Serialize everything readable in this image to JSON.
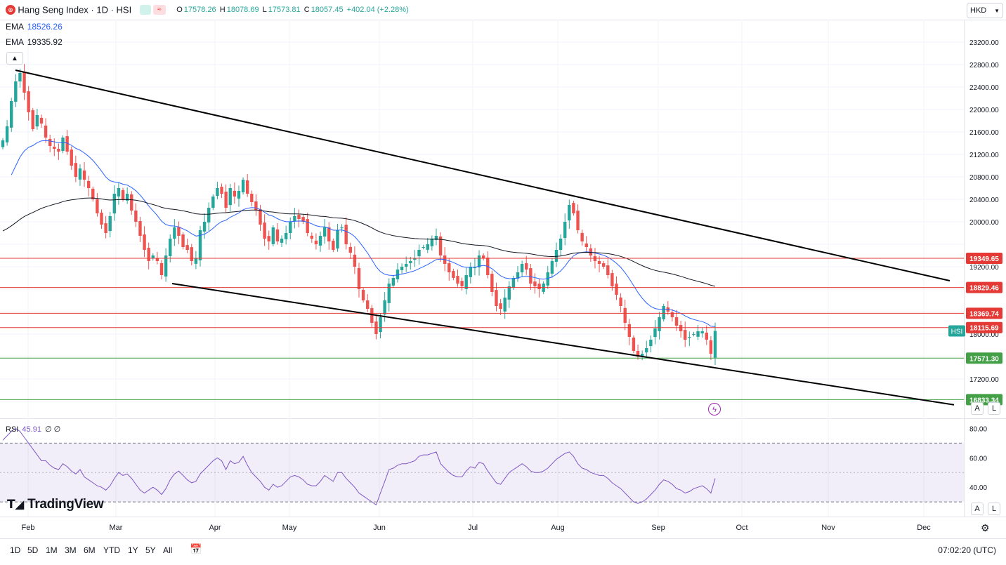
{
  "header": {
    "symbol_title": "Hang Seng Index · 1D · HSI",
    "ohlc": {
      "open_label": "O",
      "open": "17578.26",
      "high_label": "H",
      "high": "18078.69",
      "low_label": "L",
      "low": "17573.81",
      "close_label": "C",
      "close": "18057.45",
      "change": "+402.04 (+2.28%)"
    },
    "currency": "HKD"
  },
  "indicators": {
    "ema1_label": "EMA",
    "ema1_value": "18526.26",
    "ema2_label": "EMA",
    "ema2_value": "19335.92",
    "rsi_label": "RSI",
    "rsi_value": "45.91",
    "rsi_extra": "∅ ∅"
  },
  "colors": {
    "up": "#26a69a",
    "down": "#ef5350",
    "ema_short": "#2962ff",
    "ema_long": "#131722",
    "resistance": "#e53935",
    "support": "#43a047",
    "rsi": "#7e57c2",
    "trendline": "#000000"
  },
  "chart_data": [
    {
      "type": "candlestick",
      "symbol": "HSI",
      "ylim": [
        16500,
        23600
      ],
      "y_ticks": [
        16800,
        17200,
        17600,
        18000,
        18400,
        18800,
        19200,
        19600,
        20000,
        20400,
        20800,
        21200,
        21600,
        22000,
        22400,
        22800,
        23200
      ],
      "y_tick_labels": [
        "17200.00",
        "18000.00",
        "19200.00",
        "20000.00",
        "20400.00",
        "20800.00",
        "21200.00",
        "21600.00",
        "22000.00",
        "22400.00",
        "22800.00",
        "23200.00"
      ],
      "x_labels": [
        "Feb",
        "Mar",
        "Apr",
        "May",
        "Jun",
        "Jul",
        "Aug",
        "Sep",
        "Oct",
        "Nov",
        "Dec"
      ],
      "price_levels": [
        {
          "value": 19349.65,
          "label": "19349.65",
          "kind": "resistance"
        },
        {
          "value": 18829.46,
          "label": "18829.46",
          "kind": "resistance"
        },
        {
          "value": 18369.74,
          "label": "18369.74",
          "kind": "resistance"
        },
        {
          "value": 18115.69,
          "label": "18115.69",
          "kind": "resistance"
        },
        {
          "value": 17571.3,
          "label": "17571.30",
          "kind": "support"
        },
        {
          "value": 16833.34,
          "label": "16833.34",
          "kind": "support"
        }
      ],
      "current_price_label": "HSI",
      "closes": [
        21450,
        21700,
        22150,
        22500,
        22650,
        22300,
        21950,
        21650,
        21900,
        21750,
        21500,
        21350,
        21300,
        21250,
        21500,
        21250,
        21000,
        20800,
        20950,
        20750,
        20600,
        20400,
        20150,
        19950,
        19800,
        20100,
        20500,
        20600,
        20400,
        20500,
        20200,
        20000,
        19750,
        19500,
        19300,
        19400,
        19300,
        19050,
        19400,
        19700,
        19900,
        19750,
        19550,
        19500,
        19300,
        19350,
        19850,
        20000,
        20250,
        20450,
        20600,
        20500,
        20250,
        20600,
        20450,
        20550,
        20750,
        20500,
        20350,
        20200,
        19950,
        19700,
        19650,
        19900,
        19650,
        19700,
        19800,
        20000,
        20100,
        20050,
        20000,
        19800,
        19700,
        19600,
        19750,
        19900,
        19650,
        19500,
        19850,
        19900,
        19600,
        19450,
        19200,
        18800,
        18600,
        18450,
        18200,
        18000,
        18300,
        18600,
        18900,
        19000,
        19150,
        19200,
        19250,
        19300,
        19350,
        19500,
        19550,
        19600,
        19700,
        19750,
        19400,
        19250,
        19100,
        19000,
        18900,
        18850,
        19050,
        19200,
        19200,
        19400,
        19350,
        19050,
        18750,
        18500,
        18450,
        18650,
        18850,
        19000,
        19100,
        19250,
        19150,
        18900,
        18850,
        18800,
        18900,
        19100,
        19300,
        19500,
        19700,
        20000,
        20300,
        20150,
        19850,
        19650,
        19550,
        19400,
        19300,
        19250,
        19200,
        19050,
        18850,
        18700,
        18500,
        18200,
        17950,
        17700,
        17600,
        17650,
        17750,
        17900,
        18100,
        18300,
        18500,
        18400,
        18300,
        18150,
        18050,
        17900,
        17950,
        18000,
        18050,
        18050,
        17900,
        17650,
        18057
      ]
    },
    {
      "type": "line",
      "name": "RSI",
      "ylim": [
        20,
        85
      ],
      "y_ticks": [
        40,
        60,
        80
      ],
      "y_tick_labels": [
        "40.00",
        "60.00",
        "80.00"
      ],
      "band": [
        30,
        70
      ],
      "midline": 50,
      "values": [
        72,
        75,
        78,
        80,
        78,
        74,
        70,
        66,
        62,
        58,
        58,
        55,
        53,
        52,
        56,
        54,
        51,
        49,
        52,
        47,
        45,
        43,
        41,
        40,
        38,
        41,
        46,
        50,
        48,
        49,
        46,
        42,
        38,
        36,
        38,
        40,
        38,
        35,
        39,
        45,
        49,
        51,
        48,
        45,
        43,
        44,
        49,
        52,
        55,
        58,
        60,
        58,
        52,
        58,
        56,
        57,
        61,
        55,
        50,
        47,
        44,
        40,
        38,
        42,
        40,
        41,
        44,
        47,
        48,
        47,
        45,
        42,
        41,
        41,
        44,
        48,
        46,
        44,
        50,
        50,
        46,
        43,
        40,
        36,
        34,
        32,
        30,
        28,
        36,
        44,
        52,
        53,
        55,
        56,
        56,
        57,
        58,
        61,
        62,
        62,
        63,
        64,
        56,
        53,
        50,
        48,
        47,
        47,
        51,
        54,
        53,
        57,
        56,
        51,
        47,
        43,
        42,
        46,
        50,
        52,
        54,
        56,
        54,
        51,
        50,
        50,
        51,
        53,
        56,
        59,
        61,
        63,
        64,
        61,
        56,
        53,
        52,
        50,
        49,
        48,
        48,
        46,
        43,
        41,
        39,
        36,
        33,
        30,
        29,
        30,
        32,
        35,
        38,
        42,
        45,
        44,
        42,
        39,
        38,
        36,
        37,
        39,
        40,
        41,
        39,
        36,
        46
      ]
    }
  ],
  "bottom_bar": {
    "timeframes": [
      "1D",
      "5D",
      "1M",
      "3M",
      "6M",
      "YTD",
      "1Y",
      "5Y",
      "All"
    ],
    "clock": "07:02:20 (UTC)"
  },
  "scale_buttons": {
    "auto": "A",
    "log": "L"
  },
  "branding": {
    "logo_text": "TradingView"
  }
}
